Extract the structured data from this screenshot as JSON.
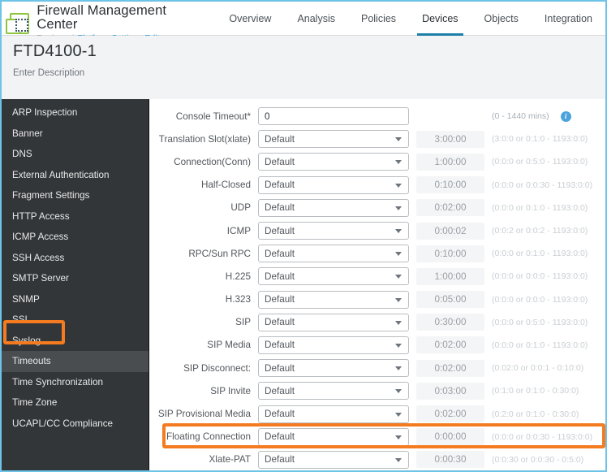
{
  "header": {
    "logo_icon": "fmc-chip-logo-icon",
    "app_title": "Firewall Management Center",
    "breadcrumb_parent": "Devices",
    "breadcrumb_sep": "/",
    "breadcrumb_current": "Platform Settings Editor",
    "nav": [
      {
        "label": "Overview",
        "active": false
      },
      {
        "label": "Analysis",
        "active": false
      },
      {
        "label": "Policies",
        "active": false
      },
      {
        "label": "Devices",
        "active": true
      },
      {
        "label": "Objects",
        "active": false
      },
      {
        "label": "Integration",
        "active": false
      }
    ],
    "accent_color": "#1d7fa8"
  },
  "page": {
    "title": "FTD4100-1",
    "description_placeholder": "Enter Description"
  },
  "sidebar": {
    "background_color": "#333638",
    "selected_label": "Timeouts",
    "items": [
      {
        "label": "ARP Inspection",
        "selected": false
      },
      {
        "label": "Banner",
        "selected": false
      },
      {
        "label": "DNS",
        "selected": false
      },
      {
        "label": "External Authentication",
        "selected": false
      },
      {
        "label": "Fragment Settings",
        "selected": false
      },
      {
        "label": "HTTP Access",
        "selected": false
      },
      {
        "label": "ICMP Access",
        "selected": false
      },
      {
        "label": "SSH Access",
        "selected": false
      },
      {
        "label": "SMTP Server",
        "selected": false
      },
      {
        "label": "SNMP",
        "selected": false
      },
      {
        "label": "SSL",
        "selected": false
      },
      {
        "label": "Syslog",
        "selected": false
      },
      {
        "label": "Timeouts",
        "selected": true
      },
      {
        "label": "Time Synchronization",
        "selected": false
      },
      {
        "label": "Time Zone",
        "selected": false
      },
      {
        "label": "UCAPL/CC Compliance",
        "selected": false
      }
    ]
  },
  "form": {
    "rows": [
      {
        "label": "Console Timeout*",
        "control": "text",
        "value": "0",
        "display_value": "",
        "hint": "(0 - 1440 mins)",
        "info_icon": "info-circle-icon",
        "has_info": true,
        "highlighted": false
      },
      {
        "label": "Translation Slot(xlate)",
        "control": "select",
        "value": "Default",
        "display_value": "3:00:00",
        "hint": "(3:0:0 or 0:1:0 - 1193:0:0)",
        "has_info": false,
        "highlighted": false
      },
      {
        "label": "Connection(Conn)",
        "control": "select",
        "value": "Default",
        "display_value": "1:00:00",
        "hint": "(0:0:0 or 0:5:0 - 1193:0:0)",
        "has_info": false,
        "highlighted": false
      },
      {
        "label": "Half-Closed",
        "control": "select",
        "value": "Default",
        "display_value": "0:10:00",
        "hint": "(0:0:0 or 0:0:30 - 1193:0:0)",
        "has_info": false,
        "highlighted": false
      },
      {
        "label": "UDP",
        "control": "select",
        "value": "Default",
        "display_value": "0:02:00",
        "hint": "(0:0:0 or 0:1:0 - 1193:0:0)",
        "has_info": false,
        "highlighted": false
      },
      {
        "label": "ICMP",
        "control": "select",
        "value": "Default",
        "display_value": "0:00:02",
        "hint": "(0:0:2 or 0:0:2 - 1193:0:0)",
        "has_info": false,
        "highlighted": false
      },
      {
        "label": "RPC/Sun RPC",
        "control": "select",
        "value": "Default",
        "display_value": "0:10:00",
        "hint": "(0:0:0 or 0:1:0 - 1193:0:0)",
        "has_info": false,
        "highlighted": false
      },
      {
        "label": "H.225",
        "control": "select",
        "value": "Default",
        "display_value": "1:00:00",
        "hint": "(0:0:0 or 0:0:0 - 1193:0:0)",
        "has_info": false,
        "highlighted": false
      },
      {
        "label": "H.323",
        "control": "select",
        "value": "Default",
        "display_value": "0:05:00",
        "hint": "(0:0:0 or 0:0:0 - 1193:0:0)",
        "has_info": false,
        "highlighted": false
      },
      {
        "label": "SIP",
        "control": "select",
        "value": "Default",
        "display_value": "0:30:00",
        "hint": "(0:0:0 or 0:5:0 - 1193:0:0)",
        "has_info": false,
        "highlighted": false
      },
      {
        "label": "SIP Media",
        "control": "select",
        "value": "Default",
        "display_value": "0:02:00",
        "hint": "(0:0:0 or 0:1:0 - 1193:0:0)",
        "has_info": false,
        "highlighted": false
      },
      {
        "label": "SIP Disconnect:",
        "control": "select",
        "value": "Default",
        "display_value": "0:02:00",
        "hint": "(0:02:0 or 0:0:1 - 0:10:0)",
        "has_info": false,
        "highlighted": false
      },
      {
        "label": "SIP Invite",
        "control": "select",
        "value": "Default",
        "display_value": "0:03:00",
        "hint": "(0:1:0 or 0:1:0 - 0:30:0)",
        "has_info": false,
        "highlighted": false
      },
      {
        "label": "SIP Provisional Media",
        "control": "select",
        "value": "Default",
        "display_value": "0:02:00",
        "hint": "(0:2:0 or 0:1:0 - 0:30:0)",
        "has_info": false,
        "highlighted": false
      },
      {
        "label": "Floating Connection",
        "control": "select",
        "value": "Default",
        "display_value": "0:00:00",
        "hint": "(0:0:0 or 0:0:30 - 1193:0:0)",
        "has_info": false,
        "highlighted": true
      },
      {
        "label": "Xlate-PAT",
        "control": "select",
        "value": "Default",
        "display_value": "0:00:30",
        "hint": "(0:0:30 or 0:0:30 - 0:5:0)",
        "has_info": false,
        "highlighted": false
      }
    ]
  },
  "annotations": {
    "highlight_color": "#f47b20",
    "targets": [
      "Timeouts",
      "Floating Connection"
    ]
  }
}
